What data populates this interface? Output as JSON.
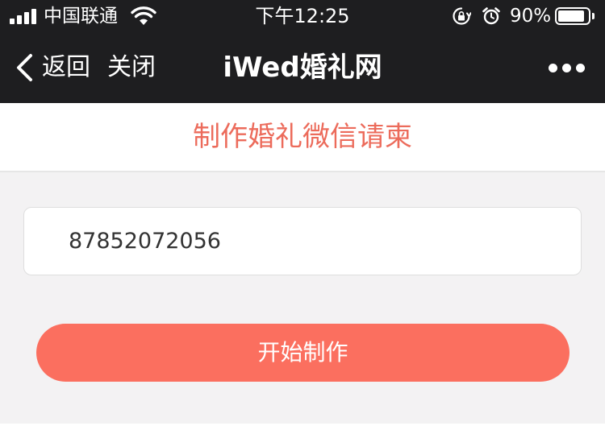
{
  "status_bar": {
    "carrier": "中国联通",
    "time": "下午12:25",
    "battery_percent_label": "90%",
    "battery_level": 0.9,
    "icons": [
      "signal-icon",
      "wifi-icon",
      "orientation-lock-icon",
      "alarm-icon",
      "battery-icon"
    ]
  },
  "nav": {
    "back_label": "返回",
    "close_label": "关闭",
    "title": "iWed婚礼网",
    "more_icon": "more-dots-icon"
  },
  "page": {
    "heading": "制作婚礼微信请柬"
  },
  "form": {
    "input_value": "87852072056",
    "submit_label": "开始制作"
  },
  "colors": {
    "header_bg": "#1e1e20",
    "accent_text": "#ec6b5b",
    "button_bg": "#fb6f5f",
    "page_bg": "#f3f2f3"
  }
}
